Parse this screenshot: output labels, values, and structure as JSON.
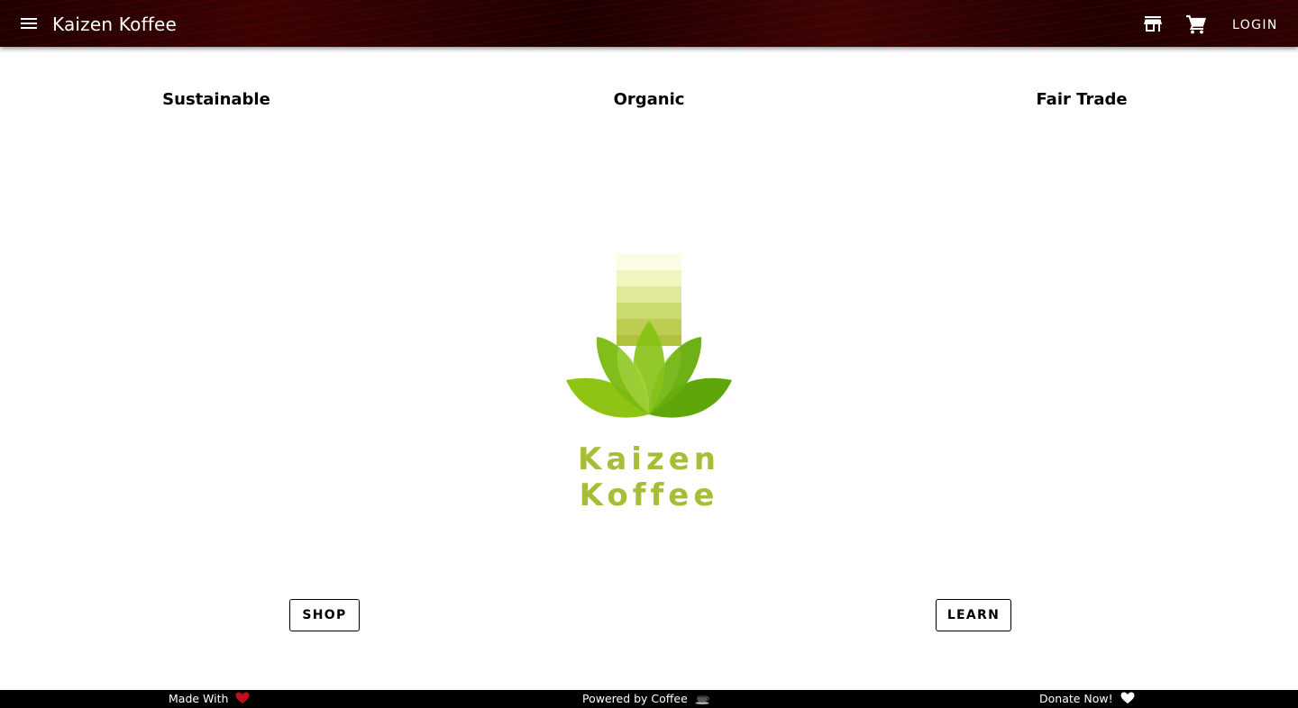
{
  "header": {
    "brand": "Kaizen Koffee",
    "login_label": "LOGIN",
    "icons": [
      "menu-icon",
      "store-icon",
      "cart-icon"
    ]
  },
  "features": [
    {
      "label": "Sustainable"
    },
    {
      "label": "Organic"
    },
    {
      "label": "Fair Trade"
    }
  ],
  "logo": {
    "text": "Kaizen Koffee",
    "colors": {
      "text": "#a7bd38",
      "leaf_light": "#9ccc1c",
      "leaf_mid": "#7dbb10",
      "leaf_dark": "#5fa40a"
    }
  },
  "actions": {
    "shop_label": "SHOP",
    "learn_label": "LEARN"
  },
  "footer": {
    "made_with": "Made With",
    "powered_by": "Powered by Coffee",
    "donate": "Donate Now!",
    "icons": [
      "heart-icon",
      "coffee-cup-icon",
      "white-heart-icon"
    ]
  },
  "colors": {
    "appbar": "#2a0202",
    "footer": "#000000",
    "heart": "#c0101a"
  }
}
